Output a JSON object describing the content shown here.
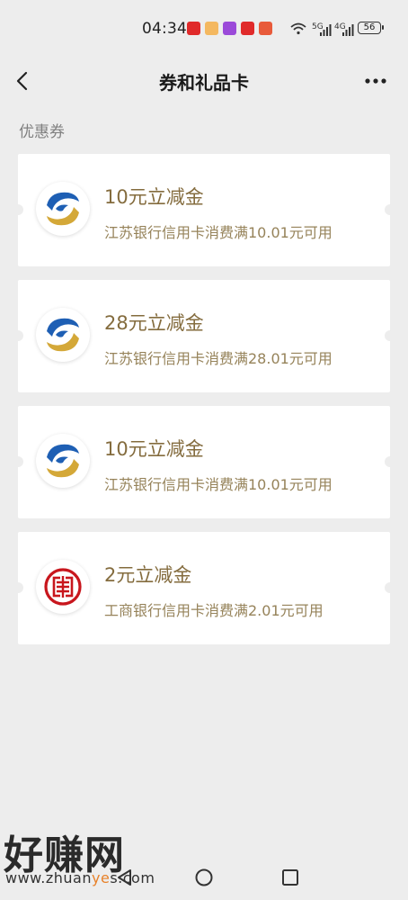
{
  "status": {
    "time": "04:34",
    "battery": "56",
    "network_1": "5G",
    "network_2": "4G"
  },
  "header": {
    "title": "券和礼品卡"
  },
  "section": {
    "label": "优惠券"
  },
  "coupons": [
    {
      "title": "10元立减金",
      "desc": "江苏银行信用卡消费满10.01元可用",
      "logo": "jiangsu-bank-logo"
    },
    {
      "title": "28元立减金",
      "desc": "江苏银行信用卡消费满28.01元可用",
      "logo": "jiangsu-bank-logo"
    },
    {
      "title": "10元立减金",
      "desc": "江苏银行信用卡消费满10.01元可用",
      "logo": "jiangsu-bank-logo"
    },
    {
      "title": "2元立减金",
      "desc": "工商银行信用卡消费满2.01元可用",
      "logo": "icbc-logo"
    }
  ],
  "watermark": {
    "brand": "好赚网",
    "domain_prefix": "www.zhuan",
    "domain_accent": "ye",
    "domain_suffix": "s.com"
  },
  "colors": {
    "background": "#ededed",
    "title_gold": "#846c3e",
    "desc_gold": "#96835a",
    "jiangsu_blue": "#1e5fb4",
    "jiangsu_gold": "#d4a838",
    "icbc_red": "#c8161d"
  }
}
